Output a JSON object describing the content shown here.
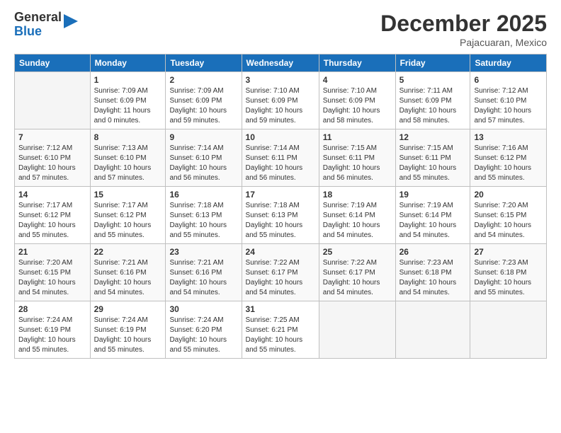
{
  "logo": {
    "general": "General",
    "blue": "Blue"
  },
  "title": "December 2025",
  "subtitle": "Pajacuaran, Mexico",
  "days_header": [
    "Sunday",
    "Monday",
    "Tuesday",
    "Wednesday",
    "Thursday",
    "Friday",
    "Saturday"
  ],
  "weeks": [
    [
      {
        "day": "",
        "sunrise": "",
        "sunset": "",
        "daylight": ""
      },
      {
        "day": "1",
        "sunrise": "Sunrise: 7:09 AM",
        "sunset": "Sunset: 6:09 PM",
        "daylight": "Daylight: 11 hours and 0 minutes."
      },
      {
        "day": "2",
        "sunrise": "Sunrise: 7:09 AM",
        "sunset": "Sunset: 6:09 PM",
        "daylight": "Daylight: 10 hours and 59 minutes."
      },
      {
        "day": "3",
        "sunrise": "Sunrise: 7:10 AM",
        "sunset": "Sunset: 6:09 PM",
        "daylight": "Daylight: 10 hours and 59 minutes."
      },
      {
        "day": "4",
        "sunrise": "Sunrise: 7:10 AM",
        "sunset": "Sunset: 6:09 PM",
        "daylight": "Daylight: 10 hours and 58 minutes."
      },
      {
        "day": "5",
        "sunrise": "Sunrise: 7:11 AM",
        "sunset": "Sunset: 6:09 PM",
        "daylight": "Daylight: 10 hours and 58 minutes."
      },
      {
        "day": "6",
        "sunrise": "Sunrise: 7:12 AM",
        "sunset": "Sunset: 6:10 PM",
        "daylight": "Daylight: 10 hours and 57 minutes."
      }
    ],
    [
      {
        "day": "7",
        "sunrise": "Sunrise: 7:12 AM",
        "sunset": "Sunset: 6:10 PM",
        "daylight": "Daylight: 10 hours and 57 minutes."
      },
      {
        "day": "8",
        "sunrise": "Sunrise: 7:13 AM",
        "sunset": "Sunset: 6:10 PM",
        "daylight": "Daylight: 10 hours and 57 minutes."
      },
      {
        "day": "9",
        "sunrise": "Sunrise: 7:14 AM",
        "sunset": "Sunset: 6:10 PM",
        "daylight": "Daylight: 10 hours and 56 minutes."
      },
      {
        "day": "10",
        "sunrise": "Sunrise: 7:14 AM",
        "sunset": "Sunset: 6:11 PM",
        "daylight": "Daylight: 10 hours and 56 minutes."
      },
      {
        "day": "11",
        "sunrise": "Sunrise: 7:15 AM",
        "sunset": "Sunset: 6:11 PM",
        "daylight": "Daylight: 10 hours and 56 minutes."
      },
      {
        "day": "12",
        "sunrise": "Sunrise: 7:15 AM",
        "sunset": "Sunset: 6:11 PM",
        "daylight": "Daylight: 10 hours and 55 minutes."
      },
      {
        "day": "13",
        "sunrise": "Sunrise: 7:16 AM",
        "sunset": "Sunset: 6:12 PM",
        "daylight": "Daylight: 10 hours and 55 minutes."
      }
    ],
    [
      {
        "day": "14",
        "sunrise": "Sunrise: 7:17 AM",
        "sunset": "Sunset: 6:12 PM",
        "daylight": "Daylight: 10 hours and 55 minutes."
      },
      {
        "day": "15",
        "sunrise": "Sunrise: 7:17 AM",
        "sunset": "Sunset: 6:12 PM",
        "daylight": "Daylight: 10 hours and 55 minutes."
      },
      {
        "day": "16",
        "sunrise": "Sunrise: 7:18 AM",
        "sunset": "Sunset: 6:13 PM",
        "daylight": "Daylight: 10 hours and 55 minutes."
      },
      {
        "day": "17",
        "sunrise": "Sunrise: 7:18 AM",
        "sunset": "Sunset: 6:13 PM",
        "daylight": "Daylight: 10 hours and 55 minutes."
      },
      {
        "day": "18",
        "sunrise": "Sunrise: 7:19 AM",
        "sunset": "Sunset: 6:14 PM",
        "daylight": "Daylight: 10 hours and 54 minutes."
      },
      {
        "day": "19",
        "sunrise": "Sunrise: 7:19 AM",
        "sunset": "Sunset: 6:14 PM",
        "daylight": "Daylight: 10 hours and 54 minutes."
      },
      {
        "day": "20",
        "sunrise": "Sunrise: 7:20 AM",
        "sunset": "Sunset: 6:15 PM",
        "daylight": "Daylight: 10 hours and 54 minutes."
      }
    ],
    [
      {
        "day": "21",
        "sunrise": "Sunrise: 7:20 AM",
        "sunset": "Sunset: 6:15 PM",
        "daylight": "Daylight: 10 hours and 54 minutes."
      },
      {
        "day": "22",
        "sunrise": "Sunrise: 7:21 AM",
        "sunset": "Sunset: 6:16 PM",
        "daylight": "Daylight: 10 hours and 54 minutes."
      },
      {
        "day": "23",
        "sunrise": "Sunrise: 7:21 AM",
        "sunset": "Sunset: 6:16 PM",
        "daylight": "Daylight: 10 hours and 54 minutes."
      },
      {
        "day": "24",
        "sunrise": "Sunrise: 7:22 AM",
        "sunset": "Sunset: 6:17 PM",
        "daylight": "Daylight: 10 hours and 54 minutes."
      },
      {
        "day": "25",
        "sunrise": "Sunrise: 7:22 AM",
        "sunset": "Sunset: 6:17 PM",
        "daylight": "Daylight: 10 hours and 54 minutes."
      },
      {
        "day": "26",
        "sunrise": "Sunrise: 7:23 AM",
        "sunset": "Sunset: 6:18 PM",
        "daylight": "Daylight: 10 hours and 54 minutes."
      },
      {
        "day": "27",
        "sunrise": "Sunrise: 7:23 AM",
        "sunset": "Sunset: 6:18 PM",
        "daylight": "Daylight: 10 hours and 55 minutes."
      }
    ],
    [
      {
        "day": "28",
        "sunrise": "Sunrise: 7:24 AM",
        "sunset": "Sunset: 6:19 PM",
        "daylight": "Daylight: 10 hours and 55 minutes."
      },
      {
        "day": "29",
        "sunrise": "Sunrise: 7:24 AM",
        "sunset": "Sunset: 6:19 PM",
        "daylight": "Daylight: 10 hours and 55 minutes."
      },
      {
        "day": "30",
        "sunrise": "Sunrise: 7:24 AM",
        "sunset": "Sunset: 6:20 PM",
        "daylight": "Daylight: 10 hours and 55 minutes."
      },
      {
        "day": "31",
        "sunrise": "Sunrise: 7:25 AM",
        "sunset": "Sunset: 6:21 PM",
        "daylight": "Daylight: 10 hours and 55 minutes."
      },
      {
        "day": "",
        "sunrise": "",
        "sunset": "",
        "daylight": ""
      },
      {
        "day": "",
        "sunrise": "",
        "sunset": "",
        "daylight": ""
      },
      {
        "day": "",
        "sunrise": "",
        "sunset": "",
        "daylight": ""
      }
    ]
  ]
}
